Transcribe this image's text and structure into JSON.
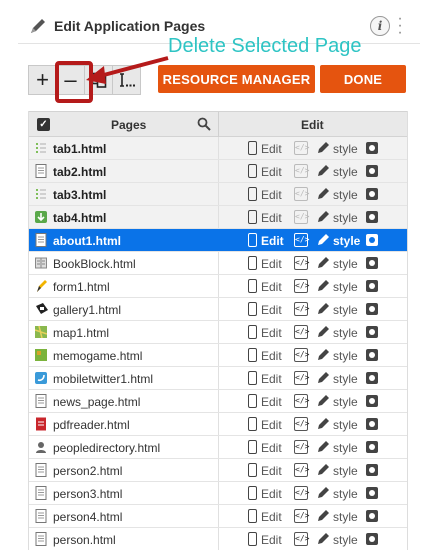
{
  "header": {
    "title": "Edit Application Pages",
    "info": "i"
  },
  "toolbar": {
    "add": "+",
    "remove": "–",
    "resource_manager": "RESOURCE MANAGER",
    "done": "DONE"
  },
  "annotation": {
    "text": "Delete Selected Page",
    "color": "#2ec4c4",
    "box_color": "#b51a1a"
  },
  "table": {
    "col_pages": "Pages",
    "col_edit": "Edit",
    "edit_label": "Edit",
    "style_label": "style",
    "rows": [
      {
        "name": "tab1.html",
        "icon": "tab-list-icon",
        "bold": true,
        "alt": true
      },
      {
        "name": "tab2.html",
        "icon": "document-icon",
        "bold": true,
        "alt": true
      },
      {
        "name": "tab3.html",
        "icon": "tab-list-icon",
        "bold": true,
        "alt": true
      },
      {
        "name": "tab4.html",
        "icon": "download-icon",
        "bold": true,
        "alt": true
      },
      {
        "name": "about1.html",
        "icon": "document-icon",
        "selected": true
      },
      {
        "name": "BookBlock.html",
        "icon": "bookblock-icon"
      },
      {
        "name": "form1.html",
        "icon": "form-icon"
      },
      {
        "name": "gallery1.html",
        "icon": "gallery-icon"
      },
      {
        "name": "map1.html",
        "icon": "map-icon"
      },
      {
        "name": "memogame.html",
        "icon": "memogame-icon"
      },
      {
        "name": "mobiletwitter1.html",
        "icon": "twitter-icon"
      },
      {
        "name": "news_page.html",
        "icon": "document-icon"
      },
      {
        "name": "pdfreader.html",
        "icon": "pdf-icon"
      },
      {
        "name": "peopledirectory.html",
        "icon": "people-icon"
      },
      {
        "name": "person2.html",
        "icon": "document-icon"
      },
      {
        "name": "person3.html",
        "icon": "document-icon"
      },
      {
        "name": "person4.html",
        "icon": "document-icon"
      },
      {
        "name": "person.html",
        "icon": "document-icon"
      }
    ]
  },
  "colors": {
    "accent": "#e5540f",
    "selected": "#0a73e8"
  }
}
